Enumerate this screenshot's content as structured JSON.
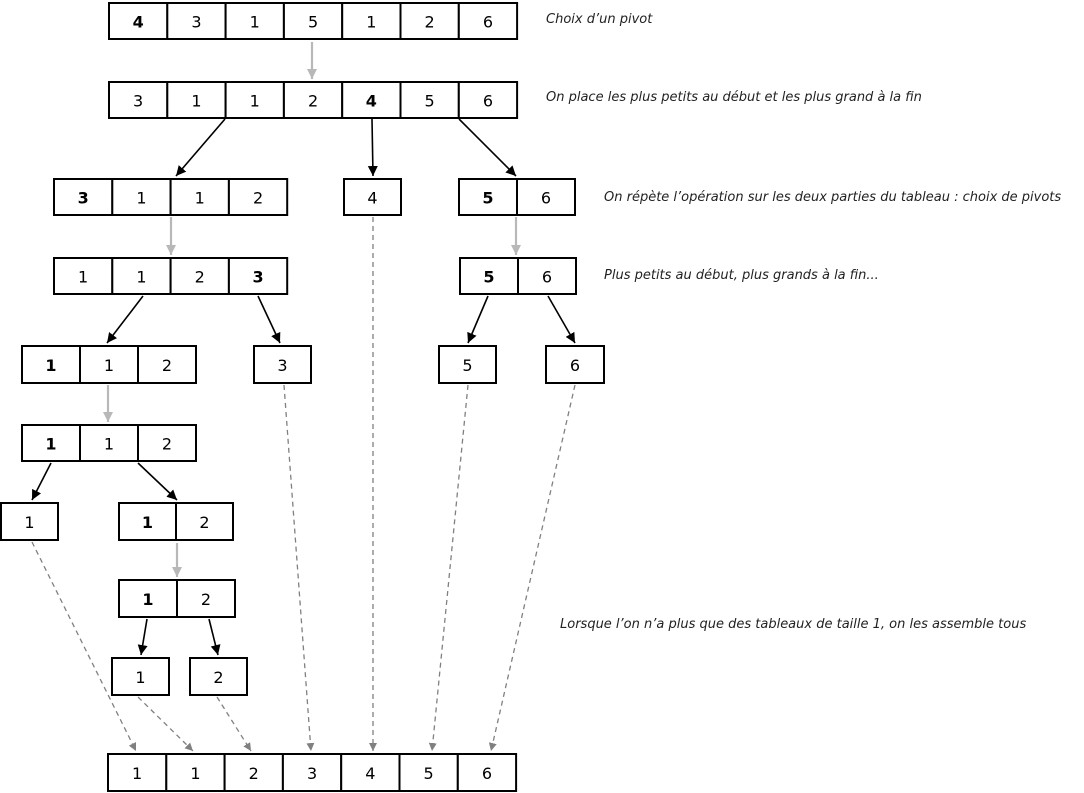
{
  "captions": {
    "c1": "Choix d’un pivot",
    "c2": "On place les plus petits au début et les plus grand  à la fin",
    "c3": "On répète l’opération sur les deux parties du tableau : choix de pivots",
    "c4": "Plus petits au début, plus grands à la fin...",
    "c5": "Lorsque l’on n’a plus que des tableaux de taille 1, on les assemble tous"
  },
  "arrays": {
    "a1": {
      "values": [
        "4",
        "3",
        "1",
        "5",
        "1",
        "2",
        "6"
      ],
      "pivot": 0
    },
    "a2": {
      "values": [
        "3",
        "1",
        "1",
        "2",
        "4",
        "5",
        "6"
      ],
      "pivot": 4
    },
    "a3l": {
      "values": [
        "3",
        "1",
        "1",
        "2"
      ],
      "pivot": 0
    },
    "a3m": {
      "values": [
        "4"
      ],
      "pivot": -1
    },
    "a3r": {
      "values": [
        "5",
        "6"
      ],
      "pivot": 0
    },
    "a4l": {
      "values": [
        "1",
        "1",
        "2",
        "3"
      ],
      "pivot": 3
    },
    "a4r": {
      "values": [
        "5",
        "6"
      ],
      "pivot": 0
    },
    "a5l": {
      "values": [
        "1",
        "1",
        "2"
      ],
      "pivot": 0
    },
    "a5m": {
      "values": [
        "3"
      ],
      "pivot": -1
    },
    "a5r1": {
      "values": [
        "5"
      ],
      "pivot": -1
    },
    "a5r2": {
      "values": [
        "6"
      ],
      "pivot": -1
    },
    "a6": {
      "values": [
        "1",
        "1",
        "2"
      ],
      "pivot": 0
    },
    "a7l": {
      "values": [
        "1"
      ],
      "pivot": -1
    },
    "a7r": {
      "values": [
        "1",
        "2"
      ],
      "pivot": 0
    },
    "a8": {
      "values": [
        "1",
        "2"
      ],
      "pivot": 0
    },
    "a9l": {
      "values": [
        "1"
      ],
      "pivot": -1
    },
    "a9r": {
      "values": [
        "2"
      ],
      "pivot": -1
    },
    "final": {
      "values": [
        "1",
        "1",
        "2",
        "3",
        "4",
        "5",
        "6"
      ],
      "pivot": -1
    }
  },
  "colors": {
    "box": "#000000",
    "arrow": "#000000",
    "step_arrow": "#b8b8b8",
    "merge_arrow": "#808080"
  }
}
